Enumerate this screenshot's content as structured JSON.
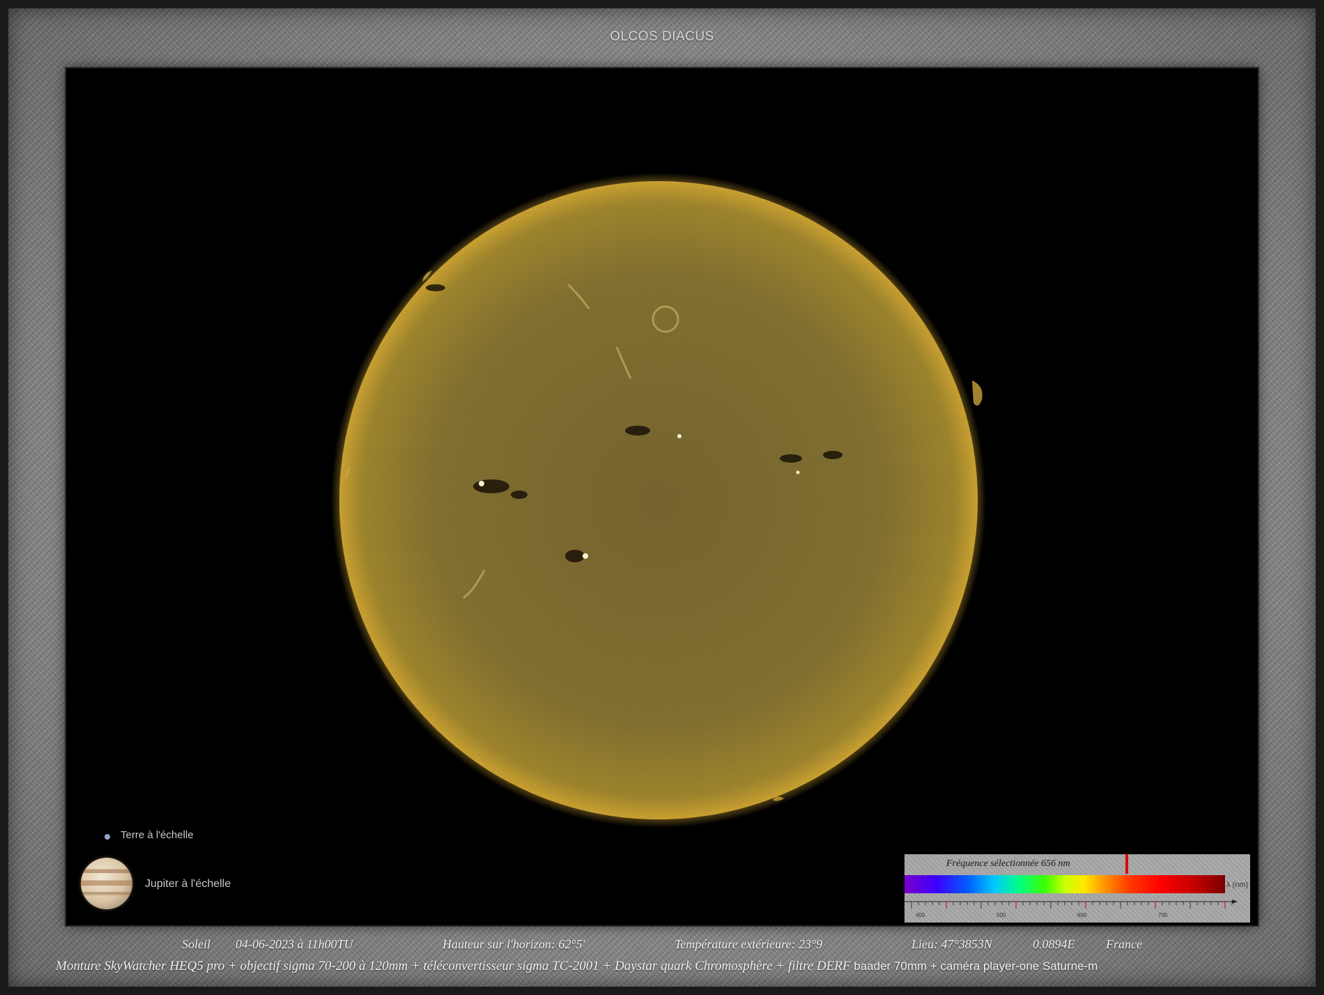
{
  "title": "OLCOS DIACUS",
  "scale": {
    "earth_label": "Terre à l'échelle",
    "jupiter_label": "Jupiter à l'échelle"
  },
  "spectrum": {
    "title": "Fréquence sélectionnée 656 nm",
    "unit": "λ (nm)",
    "ticks": [
      "400",
      "500",
      "600",
      "700"
    ]
  },
  "caption": {
    "object": "Soleil",
    "datetime": "04-06-2023  à  11h00TU",
    "altitude": "Hauteur sur l'horizon: 62°5'",
    "temperature": "Température extérieure: 23°9",
    "location": "Lieu: 47°3853N",
    "longitude": "0.0894E",
    "country": "France",
    "equipment_italic": "Monture SkyWatcher HEQ5 pro +  objectif  sigma  70-200 à 120mm  +  téléconvertisseur sigma TC-2001 +  Daystar quark Chromosphère  +  filtre DERF",
    "equipment_plain": "baader 70mm +  caméra player-one Saturne-m"
  },
  "colors": {
    "sun_center": "#8a7636",
    "sun_limb": "#f0b830",
    "background": "#000000"
  }
}
